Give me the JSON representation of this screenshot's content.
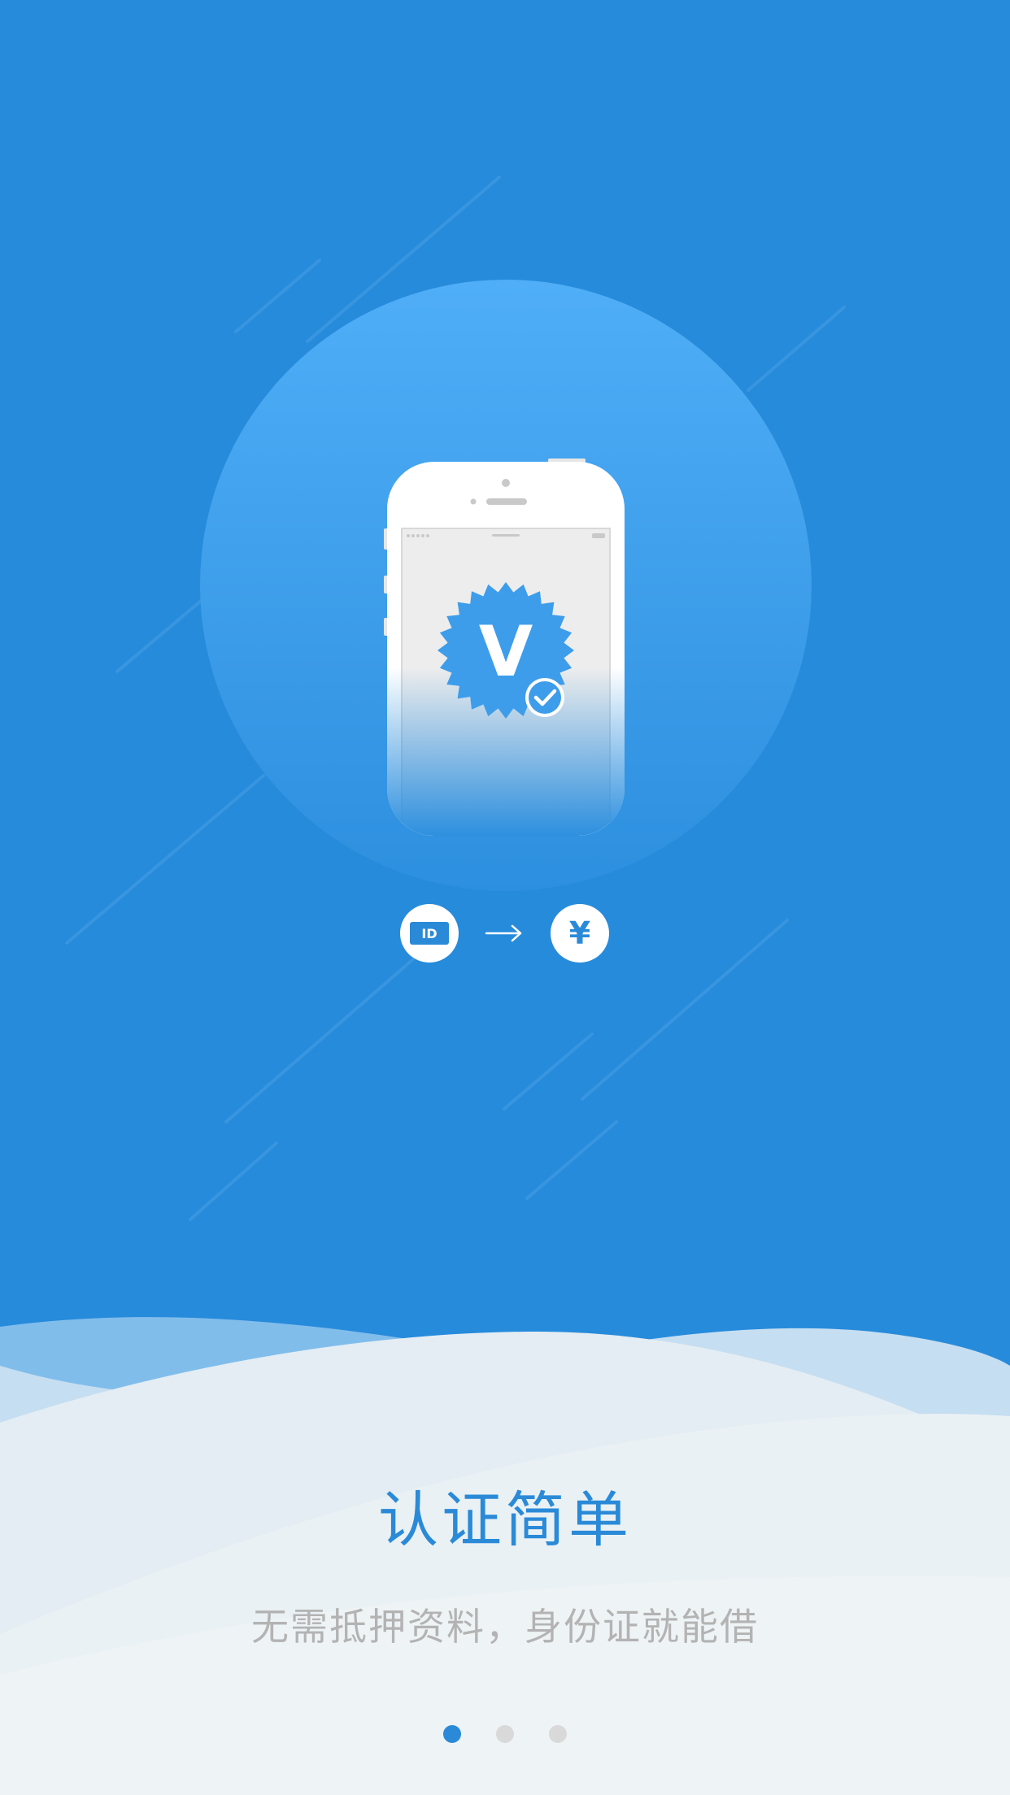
{
  "onboarding": {
    "title": "认证简单",
    "subtitle": "无需抵押资料，身份证就能借",
    "illustration": {
      "badge_letter": "V",
      "id_label": "ID",
      "currency_symbol": "¥"
    },
    "pagination": {
      "total": 3,
      "active_index": 0
    }
  },
  "colors": {
    "background": "#278BDB",
    "circle_top": "#4FAEF7",
    "accent": "#2A8AD8",
    "dot_active": "#2A8AD8",
    "dot_inactive": "#D9D9D9",
    "subtitle": "#B3B3B3"
  }
}
